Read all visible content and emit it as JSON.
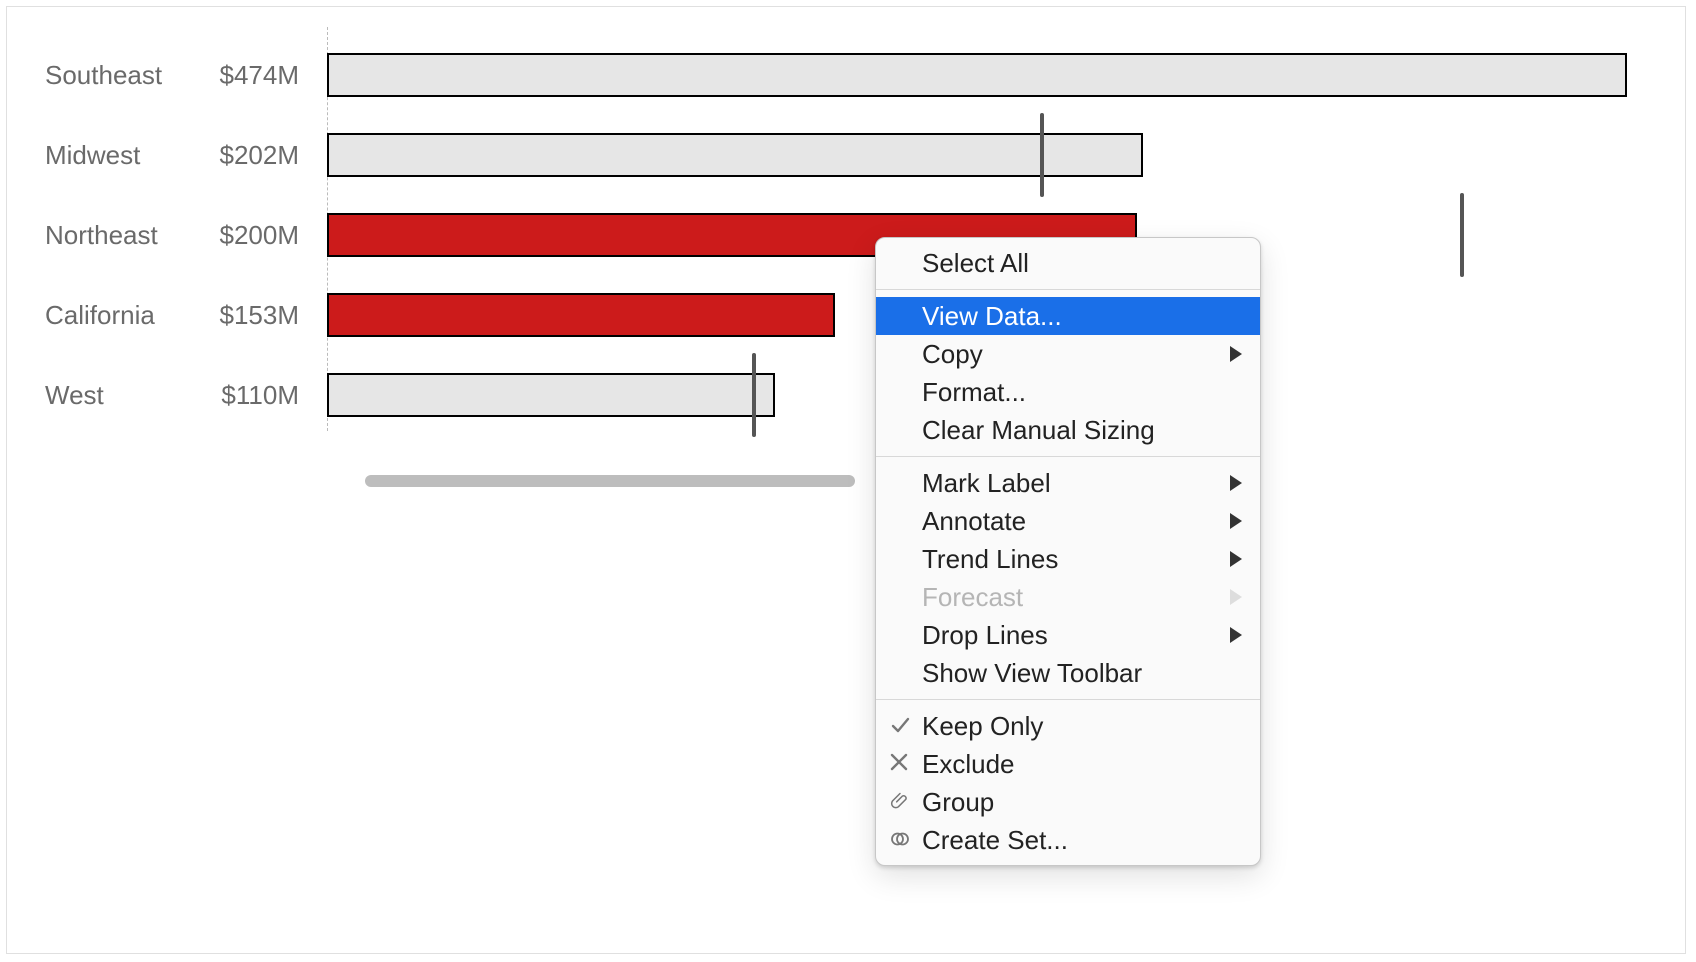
{
  "chart_data": {
    "type": "bar",
    "orientation": "horizontal",
    "categories": [
      "Southeast",
      "Midwest",
      "Northeast",
      "California",
      "West"
    ],
    "values_millions": [
      474,
      202,
      200,
      153,
      110
    ],
    "value_labels": [
      "$474M",
      "$202M",
      "$200M",
      "$153M",
      "$110M"
    ],
    "selected": [
      false,
      false,
      true,
      true,
      false
    ],
    "reference_marks_millions": [
      null,
      260,
      413,
      null,
      155
    ],
    "max_for_first_bar": 474,
    "xlim": [
      0,
      474
    ]
  },
  "context_menu": {
    "group1": [
      {
        "label": "Select All",
        "has_submenu": false
      }
    ],
    "group2": [
      {
        "label": "View Data...",
        "has_submenu": false,
        "highlighted": true
      },
      {
        "label": "Copy",
        "has_submenu": true
      },
      {
        "label": "Format...",
        "has_submenu": false
      },
      {
        "label": "Clear Manual Sizing",
        "has_submenu": false
      }
    ],
    "group3": [
      {
        "label": "Mark Label",
        "has_submenu": true
      },
      {
        "label": "Annotate",
        "has_submenu": true
      },
      {
        "label": "Trend Lines",
        "has_submenu": true
      },
      {
        "label": "Forecast",
        "has_submenu": true,
        "disabled": true
      },
      {
        "label": "Drop Lines",
        "has_submenu": true
      },
      {
        "label": "Show View Toolbar",
        "has_submenu": false
      }
    ],
    "group4": [
      {
        "label": "Keep Only",
        "icon": "check"
      },
      {
        "label": "Exclude",
        "icon": "x"
      },
      {
        "label": "Group",
        "icon": "clip"
      },
      {
        "label": "Create Set...",
        "icon": "set"
      }
    ]
  }
}
